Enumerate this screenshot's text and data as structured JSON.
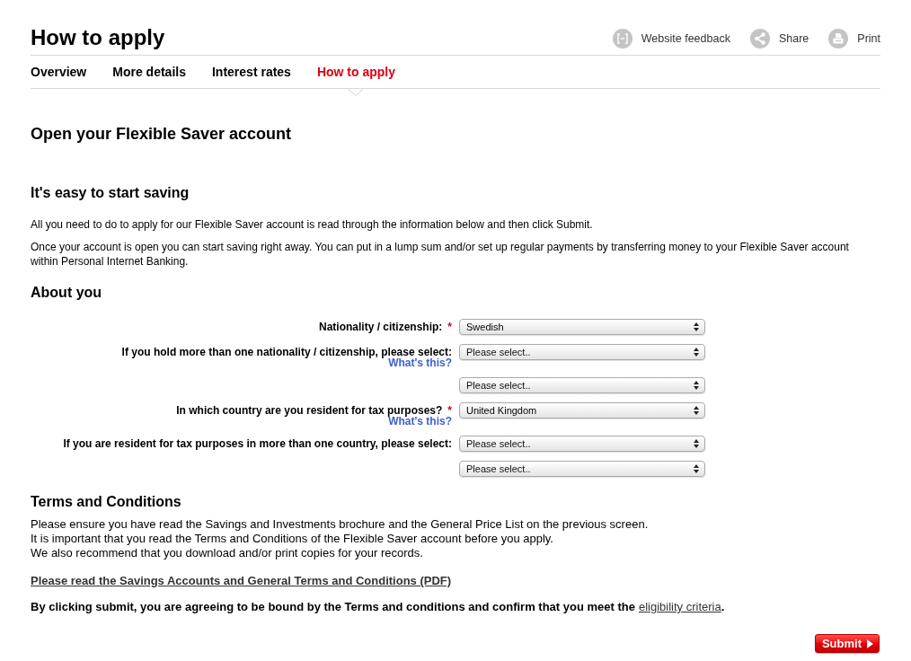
{
  "page": {
    "title": "How to apply"
  },
  "header_actions": [
    {
      "kind": "feedback",
      "label": "Website feedback"
    },
    {
      "kind": "share",
      "label": "Share"
    },
    {
      "kind": "print",
      "label": "Print"
    }
  ],
  "tabs": [
    {
      "label": "Overview",
      "selected": false
    },
    {
      "label": "More details",
      "selected": false
    },
    {
      "label": "Interest rates",
      "selected": false
    },
    {
      "label": "How to apply",
      "selected": true
    }
  ],
  "main_heading": "Open your Flexible Saver account",
  "intro": {
    "heading": "It's easy to start saving",
    "paragraphs": [
      "All you need to do to apply for our Flexible Saver account is read through the information below and then click Submit.",
      "Once your account is open you can start saving right away. You can put in a lump sum and/or set up regular payments by transferring money to your Flexible Saver account within Personal Internet Banking."
    ]
  },
  "about_you": {
    "heading": "About you",
    "fields": [
      {
        "label": "Nationality / citizenship:",
        "required_mark": "*",
        "value": "Swedish"
      },
      {
        "label": "If you hold more than one nationality / citizenship, please select:",
        "help_link": "What's this?",
        "placeholder": "Please select.."
      },
      {
        "placeholder": "Please select.."
      },
      {
        "label": "In which country are you resident for tax purposes?",
        "required_mark": "*",
        "help_link": "What's this?",
        "value": "United Kingdom"
      },
      {
        "label": "If you are resident for tax purposes in more than one country, please select:",
        "placeholder": "Please select.."
      },
      {
        "placeholder": "Please select.."
      }
    ]
  },
  "terms": {
    "heading": "Terms and Conditions",
    "lines": [
      "Please ensure you have read the Savings and Investments brochure and the General Price List on the previous screen.",
      "It is important that you read the Terms and Conditions of the Flexible Saver account before you apply.",
      "We also recommend that you download and/or print copies for your records."
    ],
    "pdf_link": "Please read the Savings Accounts and General Terms and Conditions (PDF)",
    "agreement": {
      "text": "By clicking submit, you are agreeing to be bound by the Terms and conditions and confirm that you meet the",
      "link": "eligibility criteria",
      "end": "."
    }
  },
  "submit": {
    "label": "Submit"
  }
}
